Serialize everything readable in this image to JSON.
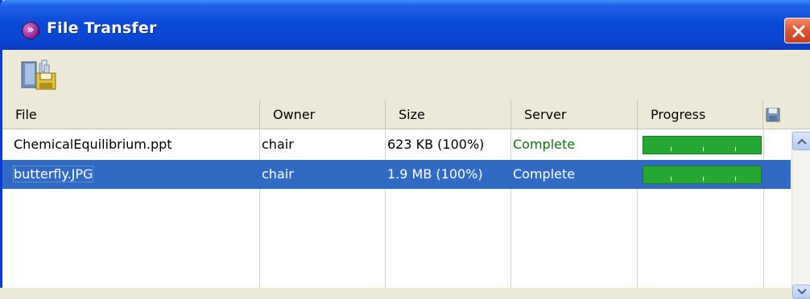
{
  "window": {
    "title": "File Transfer",
    "icons": {
      "app": "app-logo-icon",
      "close": "close-icon"
    }
  },
  "toolbar": {
    "save_tool_icon": "save-transfer-icon"
  },
  "table": {
    "columns": [
      "File",
      "Owner",
      "Size",
      "Server",
      "Progress"
    ],
    "save_column_icon": "disk-icon",
    "rows": [
      {
        "file": "ChemicalEquilibrium.ppt",
        "owner": "chair",
        "size": "623 KB (100%)",
        "server": "Complete",
        "progress": 1.0,
        "selected": false
      },
      {
        "file": "butterfly.JPG",
        "owner": "chair",
        "size": "1.9 MB (100%)",
        "server": "Complete",
        "progress": 1.0,
        "selected": true
      }
    ]
  },
  "colors": {
    "titlebar": "#0a46d2",
    "selection": "#316ac5",
    "progress_fill": "#26a834",
    "status_complete": "#0a7a0a"
  }
}
